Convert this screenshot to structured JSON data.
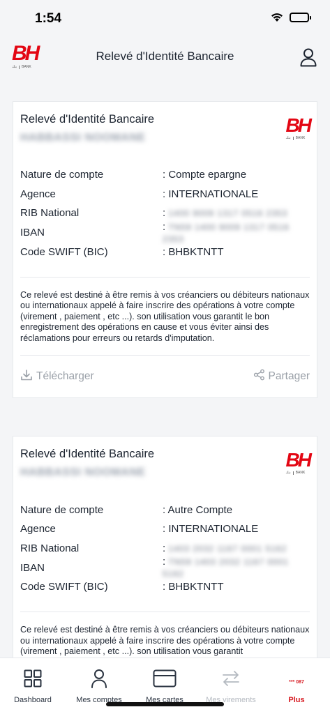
{
  "status": {
    "time": "1:54"
  },
  "header": {
    "logo_mark": "BH",
    "logo_ar": "بنك",
    "logo_bank": "BANK",
    "title": "Relevé d'Identité Bancaire"
  },
  "cards": [
    {
      "title": "Relevé d'Identité Bancaire",
      "holder": "HABBASSI NOOMANE",
      "fields": [
        {
          "label": "Nature de compte",
          "value": ": Compte epargne"
        },
        {
          "label": "Agence",
          "value": ": INTERNATIONALE"
        },
        {
          "label": "RIB National",
          "value": ":",
          "masked": "1400 9009 1317 0516 2353"
        },
        {
          "label": "IBAN",
          "value": ":",
          "masked": "TN59 1400 9009 1317 0516 2353"
        },
        {
          "label": "Code SWIFT (BIC)",
          "value": ": BHBKTNTT"
        }
      ],
      "notice": "Ce relevé est destiné à être remis à vos créanciers ou débiteurs nationaux ou internationaux appelé à faire inscrire des opérations à votre compte (virement , paiement , etc ...). son utilisation vous garantit le bon enregistrement des opérations en cause et vous éviter ainsi des réclamations pour erreurs ou retards d'imputation.",
      "download_label": "Télécharger",
      "share_label": "Partager"
    },
    {
      "title": "Relevé d'Identité Bancaire",
      "holder": "HABBASSI NOOMANE",
      "fields": [
        {
          "label": "Nature de compte",
          "value": ": Autre Compte"
        },
        {
          "label": "Agence",
          "value": ": INTERNATIONALE"
        },
        {
          "label": "RIB National",
          "value": ":",
          "masked": "1403 2032 1167 0001 5162"
        },
        {
          "label": "IBAN",
          "value": ":",
          "masked": "TN59 1403 2032 1167 0001 5162"
        },
        {
          "label": "Code SWIFT (BIC)",
          "value": ": BHBKTNTT"
        }
      ],
      "notice": "Ce relevé est destiné à être remis à vos créanciers ou débiteurs nationaux ou internationaux appelé à faire inscrire des opérations à votre compte (virement , paiement , etc ...). son utilisation vous garantit"
    }
  ],
  "nav": {
    "items": [
      {
        "label": "Dashboard",
        "icon": "dashboard-grid-icon"
      },
      {
        "label": "Mes comptes",
        "icon": "user-icon"
      },
      {
        "label": "Mes cartes",
        "icon": "card-icon"
      },
      {
        "label": "Mes virements",
        "icon": "transfer-arrows-icon"
      },
      {
        "label": "Plus",
        "icon": "more-icon",
        "badge": "*** 087"
      }
    ]
  },
  "colors": {
    "brand_red": "#e30613",
    "text": "#1c2430",
    "muted": "#9aa0a8",
    "background": "#f4f5f7"
  }
}
